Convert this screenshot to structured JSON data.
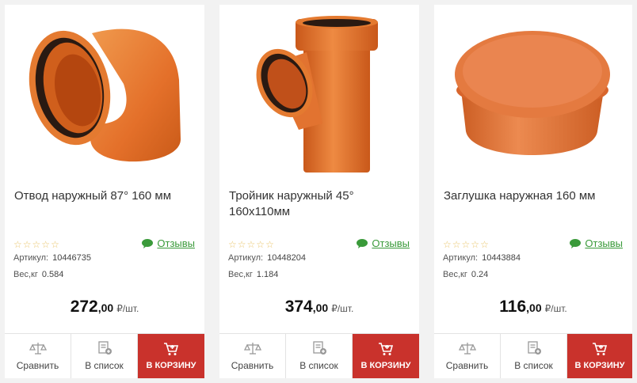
{
  "colors": {
    "accent_red": "#c9322c",
    "link_green": "#3a9a3a",
    "star_yellow": "#e9c46a",
    "pipe_orange": "#e4702a"
  },
  "products": [
    {
      "title": "Отвод наружный 87° 160 мм",
      "rating_stars": 0,
      "reviews_label": "Отзывы",
      "sku_label": "Артикул:",
      "sku": "10446735",
      "weight_label": "Вес,кг",
      "weight": "0.584",
      "price_int": "272",
      "price_dec": ",00",
      "price_unit": "₽/шт.",
      "compare_label": "Сравнить",
      "list_label": "В список",
      "cart_label": "В КОРЗИНУ",
      "image_icon": "pipe-elbow-87"
    },
    {
      "title": "Тройник наружный 45° 160х110мм",
      "rating_stars": 0,
      "reviews_label": "Отзывы",
      "sku_label": "Артикул:",
      "sku": "10448204",
      "weight_label": "Вес,кг",
      "weight": "1.184",
      "price_int": "374",
      "price_dec": ",00",
      "price_unit": "₽/шт.",
      "compare_label": "Сравнить",
      "list_label": "В список",
      "cart_label": "В КОРЗИНУ",
      "image_icon": "pipe-tee-45"
    },
    {
      "title": "Заглушка наружная 160 мм",
      "rating_stars": 0,
      "reviews_label": "Отзывы",
      "sku_label": "Артикул:",
      "sku": "10443884",
      "weight_label": "Вес,кг",
      "weight": "0.24",
      "price_int": "116",
      "price_dec": ",00",
      "price_unit": "₽/шт.",
      "compare_label": "Сравнить",
      "list_label": "В список",
      "cart_label": "В КОРЗИНУ",
      "image_icon": "pipe-cap"
    }
  ]
}
